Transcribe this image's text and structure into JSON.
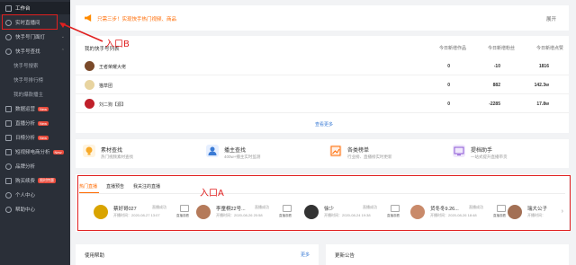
{
  "sidebar": {
    "items": [
      {
        "label": "工作台"
      },
      {
        "label": "实时直播间"
      },
      {
        "label": "快手号门面灯"
      },
      {
        "label": "快手号查找"
      },
      {
        "label": "快手号搜索"
      },
      {
        "label": "快手号排行榜"
      },
      {
        "label": "我的爆款播主"
      },
      {
        "label": "数据运营",
        "badge": "New"
      },
      {
        "label": "直播分析",
        "badge": "New"
      },
      {
        "label": "日榜分析",
        "badge": "New"
      },
      {
        "label": "短视频电商分析",
        "badge": "New"
      },
      {
        "label": "品牌分析"
      },
      {
        "label": "购买续费",
        "badge": "限时特惠"
      },
      {
        "label": "个人中心"
      },
      {
        "label": "帮助中心"
      }
    ]
  },
  "annotations": {
    "entry_b": "入口B",
    "entry_a": "入口A"
  },
  "notice": {
    "text": "只需三步！实现快手热门视频、商品",
    "expand": "展开"
  },
  "table": {
    "title": "我的快手号列表",
    "headers": [
      "今日新增作品",
      "今日新增粉丝",
      "今日新增点赞",
      "今日新增浏览量"
    ],
    "rows": [
      {
        "name": "王者荣耀大佬",
        "values": [
          "0",
          "-10",
          "1816"
        ]
      },
      {
        "name": "猫草团",
        "values": [
          "0",
          "882",
          "142.3w"
        ]
      },
      {
        "name": "刘二狗【源】",
        "values": [
          "0",
          "-2285",
          "17.8w"
        ]
      }
    ],
    "more": "查看更多"
  },
  "tools": [
    {
      "title": "素材查找",
      "sub": "热门视频素材查找",
      "color": "#f7a928"
    },
    {
      "title": "播主查找",
      "sub": "400w+播主实时监测",
      "color": "#3a7bd5"
    },
    {
      "title": "各类榜单",
      "sub": "行业榜、直播榜实时更新",
      "color": "#ff6a00"
    },
    {
      "title": "提档助手",
      "sub": "一站式提升直播带货",
      "color": "#8a56d6"
    }
  ],
  "live": {
    "tabs": [
      "热门直播",
      "直播预告",
      "我关注的直播"
    ],
    "tv_label": "直播观看",
    "streamers": [
      {
        "name": "蔡好哥027",
        "tag": "直播成功",
        "time": "开播时间：2020-08-27 13:07",
        "color": "#d9a400"
      },
      {
        "name": "李童桐22号...",
        "tag": "直播成功",
        "time": "开播时间：2020-08-26 20:58",
        "color": "#b57a5a"
      },
      {
        "name": "徐少",
        "tag": "直播成功",
        "time": "开播时间：2020-08-24 19:38",
        "color": "#333"
      },
      {
        "name": "货冬冬9.26...",
        "tag": "直播成功",
        "time": "开播时间：2020-08-26 18:48",
        "color": "#c98a6a"
      },
      {
        "name": "瑞大公子",
        "tag": "",
        "time": "开播时间：",
        "color": "#a37055"
      }
    ]
  },
  "bottom": {
    "help": "使用帮助",
    "help_more": "更多",
    "news": "更新公告"
  }
}
